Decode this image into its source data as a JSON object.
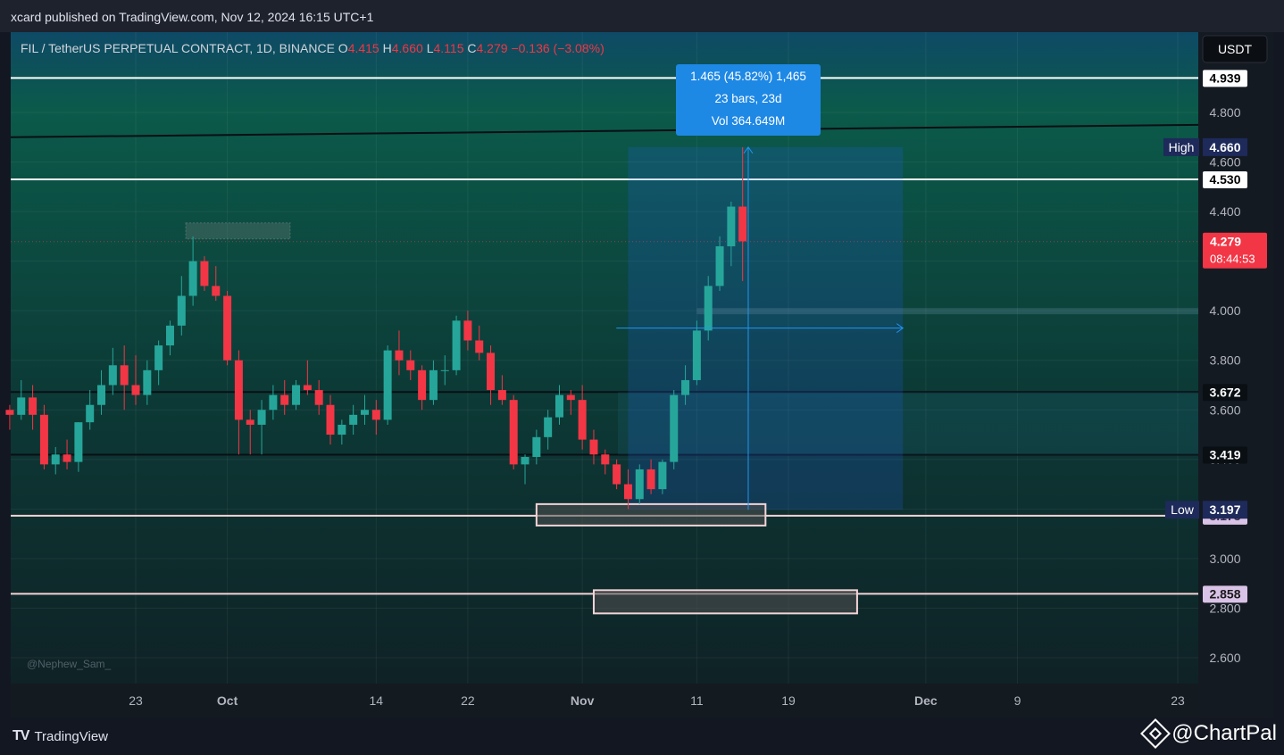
{
  "publish": "xcard published on TradingView.com, Nov 12, 2024 16:15 UTC+1",
  "symbol_title": "FIL / TetherUS PERPETUAL CONTRACT, 1D, BINANCE",
  "ohlc": {
    "o_label": "O",
    "o": "4.415",
    "h_label": "H",
    "h": "4.660",
    "l_label": "L",
    "l": "4.115",
    "c_label": "C",
    "c": "4.279",
    "change": "−0.136 (−3.08%)"
  },
  "currency": "USDT",
  "measure": {
    "line1": "1.465 (45.82%) 1,465",
    "line2": "23 bars, 23d",
    "line3": "Vol 364.649M"
  },
  "watermark": "@Nephew_Sam_",
  "footer": {
    "brand": "TradingView",
    "chartpal": "@ChartPal"
  },
  "colors": {
    "up": "#26a69a",
    "down": "#f23645",
    "measure": "#2962ff",
    "price_tag": "#f23645"
  },
  "chart_data": {
    "type": "candlestick",
    "title": "FIL / TetherUS PERPETUAL CONTRACT, 1D, BINANCE",
    "ylim": [
      2.48,
      5.05
    ],
    "y_ticks": [
      "2.600",
      "2.800",
      "3.000",
      "3.200",
      "3.400",
      "3.600",
      "3.800",
      "4.000",
      "4.200",
      "4.400",
      "4.600",
      "4.800"
    ],
    "x_ticks": [
      "23",
      "Oct",
      "14",
      "22",
      "Nov",
      "11",
      "19",
      "Dec",
      "9",
      "23"
    ],
    "x_tick_dates": [
      "2024-09-23",
      "2024-10-01",
      "2024-10-14",
      "2024-10-22",
      "2024-11-01",
      "2024-11-11",
      "2024-11-19",
      "2024-12-01",
      "2024-12-09",
      "2024-12-23"
    ],
    "x_start_date": "2024-09-12",
    "ohlc": [
      [
        "2024-09-12",
        3.6,
        3.62,
        3.52,
        3.58
      ],
      [
        "2024-09-13",
        3.58,
        3.72,
        3.56,
        3.65
      ],
      [
        "2024-09-14",
        3.65,
        3.7,
        3.52,
        3.58
      ],
      [
        "2024-09-15",
        3.58,
        3.62,
        3.36,
        3.38
      ],
      [
        "2024-09-16",
        3.38,
        3.45,
        3.34,
        3.42
      ],
      [
        "2024-09-17",
        3.42,
        3.48,
        3.36,
        3.39
      ],
      [
        "2024-09-18",
        3.39,
        3.55,
        3.35,
        3.55
      ],
      [
        "2024-09-19",
        3.55,
        3.68,
        3.52,
        3.62
      ],
      [
        "2024-09-20",
        3.62,
        3.76,
        3.58,
        3.7
      ],
      [
        "2024-09-21",
        3.7,
        3.85,
        3.66,
        3.78
      ],
      [
        "2024-09-22",
        3.78,
        3.86,
        3.6,
        3.7
      ],
      [
        "2024-09-23",
        3.7,
        3.82,
        3.62,
        3.66
      ],
      [
        "2024-09-24",
        3.66,
        3.8,
        3.62,
        3.76
      ],
      [
        "2024-09-25",
        3.76,
        3.88,
        3.7,
        3.86
      ],
      [
        "2024-09-26",
        3.86,
        3.96,
        3.82,
        3.94
      ],
      [
        "2024-09-27",
        3.94,
        4.14,
        3.9,
        4.06
      ],
      [
        "2024-09-28",
        4.06,
        4.3,
        4.02,
        4.2
      ],
      [
        "2024-09-29",
        4.2,
        4.22,
        4.08,
        4.1
      ],
      [
        "2024-09-30",
        4.1,
        4.18,
        4.04,
        4.06
      ],
      [
        "2024-10-01",
        4.06,
        4.08,
        3.78,
        3.8
      ],
      [
        "2024-10-02",
        3.8,
        3.84,
        3.42,
        3.56
      ],
      [
        "2024-10-03",
        3.56,
        3.6,
        3.42,
        3.54
      ],
      [
        "2024-10-04",
        3.54,
        3.64,
        3.42,
        3.6
      ],
      [
        "2024-10-05",
        3.6,
        3.7,
        3.56,
        3.66
      ],
      [
        "2024-10-06",
        3.66,
        3.72,
        3.58,
        3.62
      ],
      [
        "2024-10-07",
        3.62,
        3.72,
        3.6,
        3.7
      ],
      [
        "2024-10-08",
        3.7,
        3.8,
        3.66,
        3.68
      ],
      [
        "2024-10-09",
        3.68,
        3.72,
        3.58,
        3.62
      ],
      [
        "2024-10-10",
        3.62,
        3.66,
        3.46,
        3.5
      ],
      [
        "2024-10-11",
        3.5,
        3.56,
        3.46,
        3.54
      ],
      [
        "2024-10-12",
        3.54,
        3.62,
        3.5,
        3.58
      ],
      [
        "2024-10-13",
        3.58,
        3.66,
        3.54,
        3.6
      ],
      [
        "2024-10-14",
        3.6,
        3.64,
        3.5,
        3.56
      ],
      [
        "2024-10-15",
        3.56,
        3.86,
        3.54,
        3.84
      ],
      [
        "2024-10-16",
        3.84,
        3.92,
        3.74,
        3.8
      ],
      [
        "2024-10-17",
        3.8,
        3.84,
        3.72,
        3.76
      ],
      [
        "2024-10-18",
        3.76,
        3.78,
        3.6,
        3.64
      ],
      [
        "2024-10-19",
        3.64,
        3.8,
        3.62,
        3.76
      ],
      [
        "2024-10-20",
        3.76,
        3.82,
        3.7,
        3.76
      ],
      [
        "2024-10-21",
        3.76,
        3.98,
        3.74,
        3.96
      ],
      [
        "2024-10-22",
        3.96,
        4.0,
        3.84,
        3.88
      ],
      [
        "2024-10-23",
        3.88,
        3.94,
        3.8,
        3.83
      ],
      [
        "2024-10-24",
        3.83,
        3.86,
        3.62,
        3.68
      ],
      [
        "2024-10-25",
        3.68,
        3.74,
        3.62,
        3.64
      ],
      [
        "2024-10-26",
        3.64,
        3.66,
        3.36,
        3.38
      ],
      [
        "2024-10-27",
        3.38,
        3.42,
        3.3,
        3.41
      ],
      [
        "2024-10-28",
        3.41,
        3.52,
        3.38,
        3.49
      ],
      [
        "2024-10-29",
        3.49,
        3.6,
        3.44,
        3.57
      ],
      [
        "2024-10-30",
        3.57,
        3.7,
        3.54,
        3.66
      ],
      [
        "2024-10-31",
        3.66,
        3.68,
        3.58,
        3.64
      ],
      [
        "2024-11-01",
        3.64,
        3.7,
        3.44,
        3.48
      ],
      [
        "2024-11-02",
        3.48,
        3.52,
        3.38,
        3.42
      ],
      [
        "2024-11-03",
        3.42,
        3.44,
        3.34,
        3.38
      ],
      [
        "2024-11-04",
        3.38,
        3.4,
        3.28,
        3.3
      ],
      [
        "2024-11-05",
        3.3,
        3.36,
        3.2,
        3.24
      ],
      [
        "2024-11-06",
        3.24,
        3.38,
        3.22,
        3.36
      ],
      [
        "2024-11-07",
        3.36,
        3.4,
        3.26,
        3.28
      ],
      [
        "2024-11-08",
        3.28,
        3.4,
        3.26,
        3.39
      ],
      [
        "2024-11-09",
        3.39,
        3.68,
        3.36,
        3.66
      ],
      [
        "2024-11-10",
        3.66,
        3.78,
        3.62,
        3.72
      ],
      [
        "2024-11-11",
        3.72,
        3.96,
        3.7,
        3.92
      ],
      [
        "2024-11-12",
        3.92,
        4.14,
        3.88,
        4.1
      ],
      [
        "2024-11-13",
        4.1,
        4.3,
        4.08,
        4.26
      ],
      [
        "2024-11-14",
        4.26,
        4.44,
        4.18,
        4.42
      ],
      [
        "2024-11-15",
        4.42,
        4.66,
        4.12,
        4.28
      ]
    ],
    "price_levels": [
      "4.939",
      "4.530",
      "3.672",
      "3.419",
      "3.173",
      "2.858"
    ],
    "high_label": "High",
    "high": "4.660",
    "low_label": "Low",
    "low": "3.197",
    "last_price": "4.279",
    "countdown": "08:44:53",
    "grid": true
  }
}
